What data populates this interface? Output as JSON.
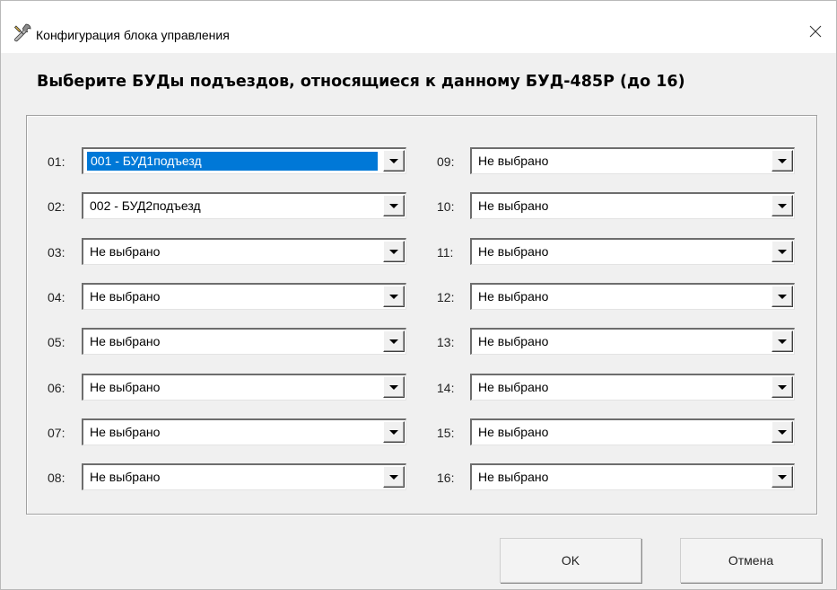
{
  "window": {
    "title": "Конфигурация блока управления",
    "close_glyph": "✕",
    "title_icon": "wrench-screwdriver-icon"
  },
  "heading": "Выберите БУДы подъездов, относящиеся к данному БУД-485Р (до 16)",
  "slots": [
    {
      "num": "01:",
      "value": "001 - БУД1подъезд",
      "selected": true
    },
    {
      "num": "02:",
      "value": "002 - БУД2подъезд"
    },
    {
      "num": "03:",
      "value": "Не выбрано"
    },
    {
      "num": "04:",
      "value": "Не выбрано"
    },
    {
      "num": "05:",
      "value": "Не выбрано"
    },
    {
      "num": "06:",
      "value": "Не выбрано"
    },
    {
      "num": "07:",
      "value": "Не выбрано"
    },
    {
      "num": "08:",
      "value": "Не выбрано"
    },
    {
      "num": "09:",
      "value": "Не выбрано"
    },
    {
      "num": "10:",
      "value": "Не выбрано"
    },
    {
      "num": "11:",
      "value": "Не выбрано"
    },
    {
      "num": "12:",
      "value": "Не выбрано"
    },
    {
      "num": "13:",
      "value": "Не выбрано"
    },
    {
      "num": "14:",
      "value": "Не выбрано"
    },
    {
      "num": "15:",
      "value": "Не выбрано"
    },
    {
      "num": "16:",
      "value": "Не выбрано"
    }
  ],
  "buttons": {
    "ok": "OK",
    "cancel": "Отмена"
  },
  "colors": {
    "selection": "#0078d7",
    "window_bg": "#f0f0f0"
  }
}
